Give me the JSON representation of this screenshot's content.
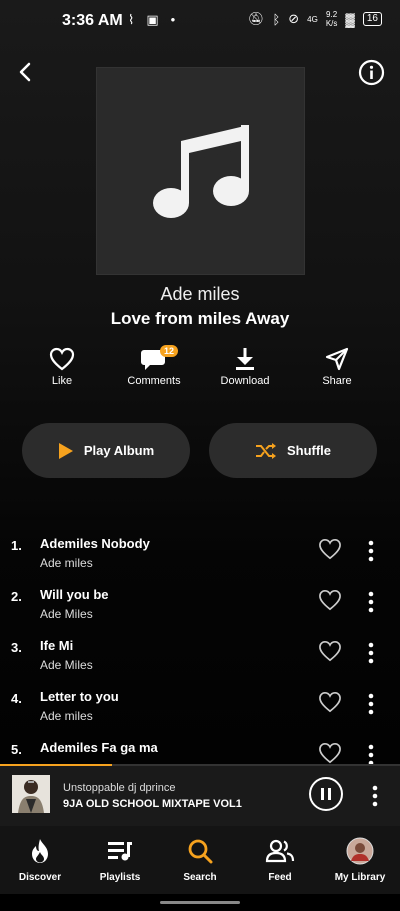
{
  "status_bar": {
    "time": "3:36 AM",
    "net_speed_value": "9.2",
    "net_speed_unit": "K/s",
    "network_type": "4G",
    "battery": "16"
  },
  "header": {
    "back_icon": "chevron-left-icon",
    "info_icon": "info-circle-icon"
  },
  "album": {
    "artist": "Ade miles",
    "title": "Love from miles Away",
    "art_icon": "music-note-icon"
  },
  "actions": [
    {
      "label": "Like",
      "icon": "heart-icon"
    },
    {
      "label": "Comments",
      "icon": "comment-icon",
      "badge": "12"
    },
    {
      "label": "Download",
      "icon": "download-icon"
    },
    {
      "label": "Share",
      "icon": "share-icon"
    }
  ],
  "buttons": {
    "play_album": "Play Album",
    "shuffle": "Shuffle"
  },
  "tracks": [
    {
      "num": "1.",
      "title": "Ademiles Nobody",
      "artist": "Ade miles"
    },
    {
      "num": "2.",
      "title": "Will you be",
      "artist": "Ade Miles"
    },
    {
      "num": "3.",
      "title": "Ife Mi",
      "artist": "Ade Miles"
    },
    {
      "num": "4.",
      "title": "Letter to you",
      "artist": "Ade miles"
    },
    {
      "num": "5.",
      "title": "Ademiles Fa ga ma",
      "artist": ""
    }
  ],
  "mini_player": {
    "title": "Unstoppable dj dprince",
    "subtitle": "9JA OLD SCHOOL MIXTAPE VOL1",
    "progress": 0.28
  },
  "nav": [
    {
      "label": "Discover",
      "icon": "fire-icon",
      "active": false
    },
    {
      "label": "Playlists",
      "icon": "playlist-icon",
      "active": false
    },
    {
      "label": "Search",
      "icon": "search-icon",
      "active": true
    },
    {
      "label": "Feed",
      "icon": "people-icon",
      "active": false
    },
    {
      "label": "My Library",
      "icon": "avatar-icon",
      "active": false
    }
  ],
  "colors": {
    "accent": "#f6a21e",
    "background": "#000000",
    "pill": "#2c2c2c"
  }
}
